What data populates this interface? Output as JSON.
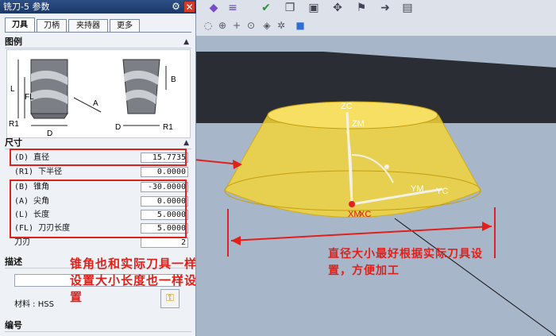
{
  "dialog": {
    "title": "铣刀-5 参数",
    "tabs": [
      "刀具",
      "刀柄",
      "夹持器",
      "更多"
    ],
    "sections": {
      "figure": "图例",
      "dimensions": "尺寸",
      "description": "描述",
      "number": "编号"
    },
    "figure_labels": {
      "L": "L",
      "FL": "FL",
      "R1_left": "R1",
      "D_left": "D",
      "A": "A",
      "B": "B",
      "D_right": "D",
      "R1_right": "R1"
    },
    "params": [
      {
        "label": "(D) 直径",
        "value": "15.7735"
      },
      {
        "label": "(R1) 下半径",
        "value": "0.0000"
      },
      {
        "label": "(B) 锥角",
        "value": "-30.0000"
      },
      {
        "label": "(A) 尖角",
        "value": "0.0000"
      },
      {
        "label": "(L) 长度",
        "value": "5.0000"
      },
      {
        "label": "(FL) 刀刃长度",
        "value": "5.0000"
      },
      {
        "label": "刀刃",
        "value": "2"
      }
    ],
    "material": "材料 : HSS"
  },
  "annotations": {
    "left": "锥角也和实际刀具一样设置大小长度也一样设置",
    "right": "直径大小最好根据实际刀具设置，方便加工"
  },
  "axes": {
    "zc": "ZC",
    "zm": "ZM",
    "ym": "YM",
    "yc": "YC",
    "xm": "XM",
    "xc": "XC"
  },
  "colors": {
    "accent_red": "#e0201a",
    "tool_yellow": "#f2d43a",
    "viewport_bg": "#a8b6c9",
    "title_blue": "#1c3768"
  },
  "icons": [
    "gear-icon",
    "close-icon"
  ]
}
